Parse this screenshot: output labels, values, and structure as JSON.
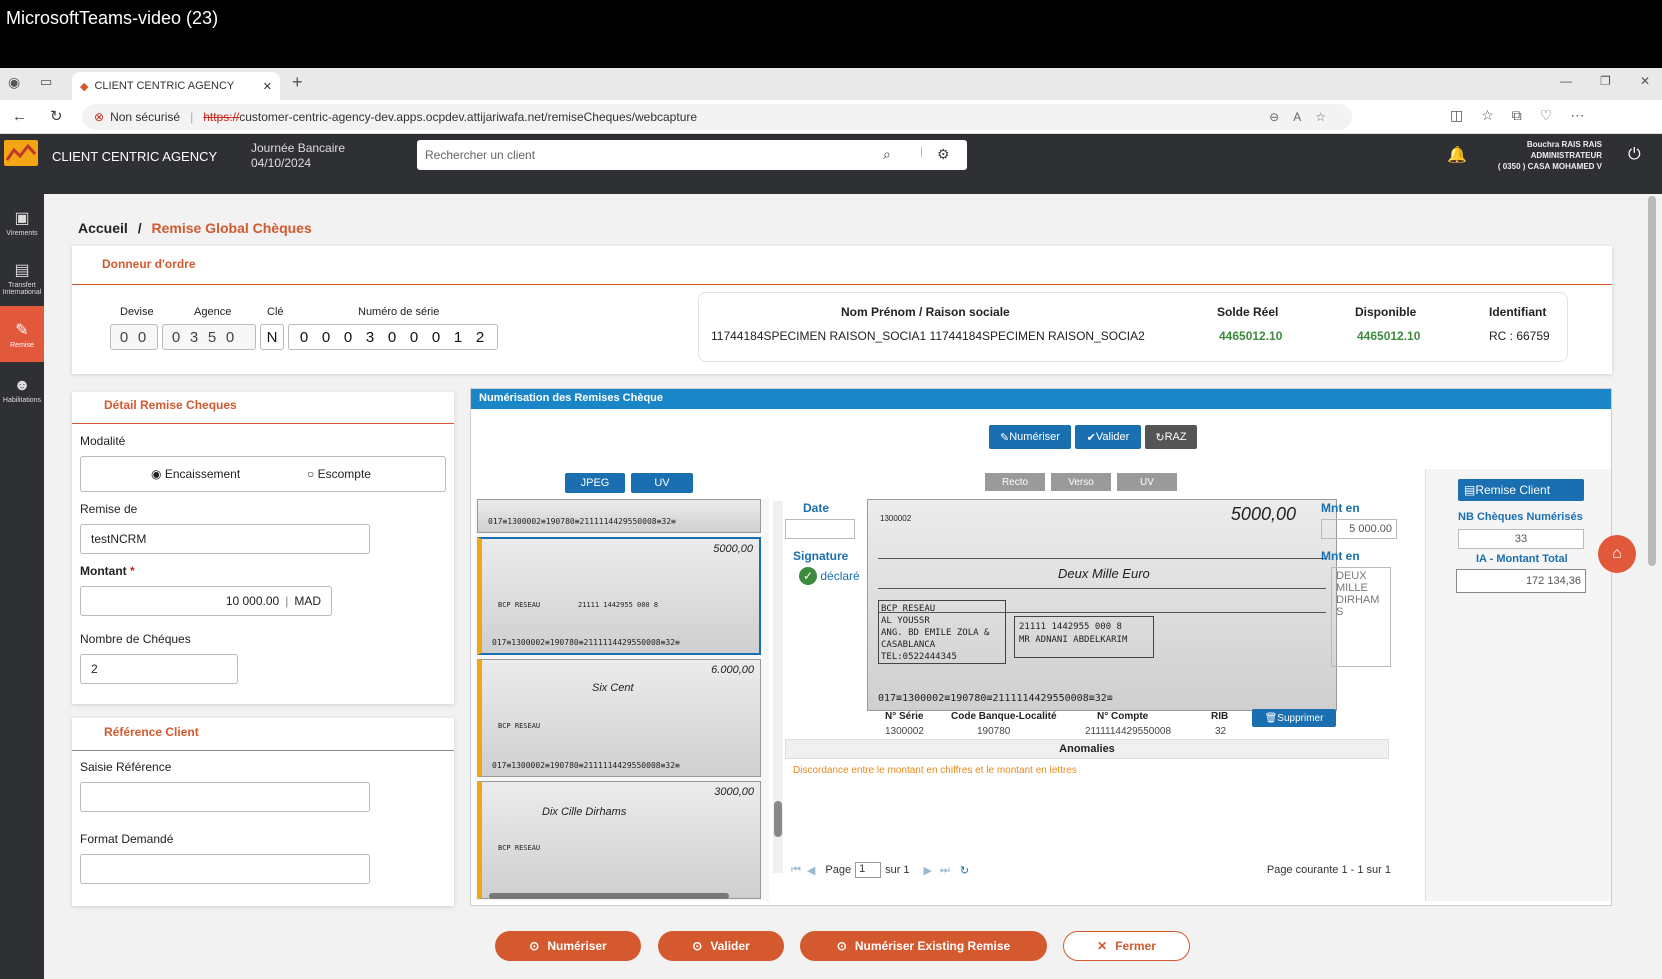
{
  "window": {
    "title": "MicrosoftTeams-video (23)"
  },
  "browser": {
    "tab_title": "CLIENT CENTRIC AGENCY",
    "security": "Non sécurisé",
    "url_https": "https://",
    "url_rest": "customer-centric-agency-dev.apps.ocpdev.attijariwafa.net/remiseCheques/webcapture"
  },
  "header": {
    "app_name": "CLIENT CENTRIC AGENCY",
    "day_label": "Journée Bancaire",
    "day_date": "04/10/2024",
    "search_placeholder": "Rechercher un client",
    "user_name": "Bouchra RAIS RAIS",
    "user_role": "ADMINISTRATEUR",
    "user_agency": "( 0350 ) CASA MOHAMED V"
  },
  "sidenav": [
    {
      "label": "Virements",
      "icon": "wallet-icon"
    },
    {
      "label": "Transfert International",
      "icon": "money-icon"
    },
    {
      "label": "Remise",
      "icon": "edit-icon"
    },
    {
      "label": "Habilitations",
      "icon": "users-icon"
    }
  ],
  "breadcrumb": {
    "home": "Accueil",
    "sep": "/",
    "current": "Remise Global Chèques"
  },
  "donneur": {
    "title": "Donneur d'ordre",
    "devise_label": "Devise",
    "devise": [
      "0",
      "0"
    ],
    "agence_label": "Agence",
    "agence": [
      "0",
      "3",
      "5",
      "0"
    ],
    "cle_label": "Clé",
    "cle": "N",
    "serie_label": "Numéro de série",
    "serie": [
      "0",
      "0",
      "0",
      "3",
      "0",
      "0",
      "0",
      "1",
      "2"
    ]
  },
  "client": {
    "name_header": "Nom Prénom / Raison sociale",
    "name": "11744184SPECIMEN RAISON_SOCIA1 11744184SPECIMEN RAISON_SOCIA2",
    "solde_header": "Solde Réel",
    "solde": "4465012.10",
    "dispo_header": "Disponible",
    "dispo": "4465012.10",
    "id_header": "Identifiant",
    "id": "RC : 66759"
  },
  "detail": {
    "title": "Détail Remise Cheques",
    "modalite_label": "Modalité",
    "opt1": "Encaissement",
    "opt2": "Escompte",
    "remise_label": "Remise de",
    "remise_value": "testNCRM",
    "montant_label": "Montant",
    "required": "*",
    "montant_value": "10 000.00",
    "devise": "MAD",
    "nb_label": "Nombre de Chéques",
    "nb_value": "2"
  },
  "reference": {
    "title": "Référence Client",
    "saisie_label": "Saisie Référence",
    "format_label": "Format Demandé"
  },
  "scan": {
    "title": "Numérisation des Remises Chèque",
    "btn_numeriser": "Numériser",
    "btn_valider": "Valider",
    "btn_raz": "RAZ",
    "btn_jpeg": "JPEG",
    "btn_uv": "UV",
    "btn_recto": "Recto",
    "btn_verso": "Verso",
    "btn_uv2": "UV",
    "date_label": "Date",
    "signature_label": "Signature",
    "signature_sub": "déclaré",
    "mnt_label1": "Mnt en",
    "mnt_value": "5 000.00",
    "mnt_label2": "Mnt en",
    "mnt_letters": "DEUX MILLE DIRHAMS",
    "remise_client": "Remise Client",
    "nb_cheques_label": "NB Chèques Numérisés",
    "nb_cheques": "33",
    "montant_total_label": "IA - Montant Total",
    "montant_total": "172 134,36"
  },
  "cheque": {
    "amount_text": "5000,00",
    "payee_text": "Deux Mille Euro",
    "bank": "BCP RESEAU",
    "addr1": "AL YOUSSR",
    "addr2": "ANG. BD EMILE ZOLA &",
    "addr3": "CASABLANCA",
    "addr4": "TEL:0522444345",
    "account": "21111 1442955 000 8",
    "holder": "MR ADNANI ABDELKARIM",
    "micr": "017≡1300002≡190780≡2111114429550008≡32≡",
    "serie_no": "1300002"
  },
  "thumbs": [
    {
      "amount": "5000,00",
      "text": ""
    },
    {
      "amount": "6.000,00",
      "text": "Six Cent"
    },
    {
      "amount": "3000,00",
      "text": "Dix Cille Dirhams"
    }
  ],
  "detail_row": {
    "h_serie": "N° Série",
    "h_code": "Code Banque-Localité",
    "h_compte": "N° Compte",
    "h_rib": "RIB",
    "serie": "1300002",
    "code": "190780",
    "compte": "2111114429550008",
    "rib": "32",
    "btn_supprimer": "Supprimer"
  },
  "anomalies": {
    "title": "Anomalies",
    "text": "Discordance entre le montant en chiffres et le montant en lettres"
  },
  "pager": {
    "page_label": "Page",
    "page_value": "1",
    "sur": "sur 1",
    "courante": "Page courante 1 - 1 sur 1"
  },
  "footer": {
    "numeriser": "Numériser",
    "valider": "Valider",
    "existing": "Numériser Existing Remise",
    "fermer": "Fermer"
  },
  "colors": {
    "accent": "#d4592e",
    "blue": "#1a6fb0",
    "dark": "#2f3033",
    "green": "#3c8a3e"
  }
}
